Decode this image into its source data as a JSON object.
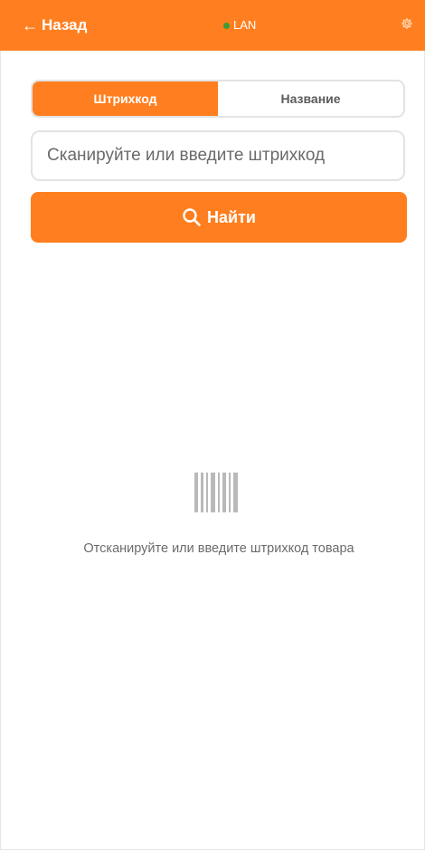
{
  "header": {
    "back_label": "Назад",
    "back_icon": "arrow-left-icon",
    "connection_label": "LAN",
    "connection_status_color": "#3f9a37",
    "settings_icon": "gear-icon",
    "accent_color": "#ff7f20"
  },
  "tabs": [
    {
      "label": "Штрихкод",
      "active": true
    },
    {
      "label": "Название",
      "active": false
    }
  ],
  "search": {
    "value": "",
    "placeholder": "Сканируйте или введите штрихкод"
  },
  "find_button": {
    "label": "Найти",
    "icon": "search-icon"
  },
  "empty_state": {
    "icon": "barcode-icon",
    "message": "Отсканируйте или введите штрихкод товара"
  }
}
